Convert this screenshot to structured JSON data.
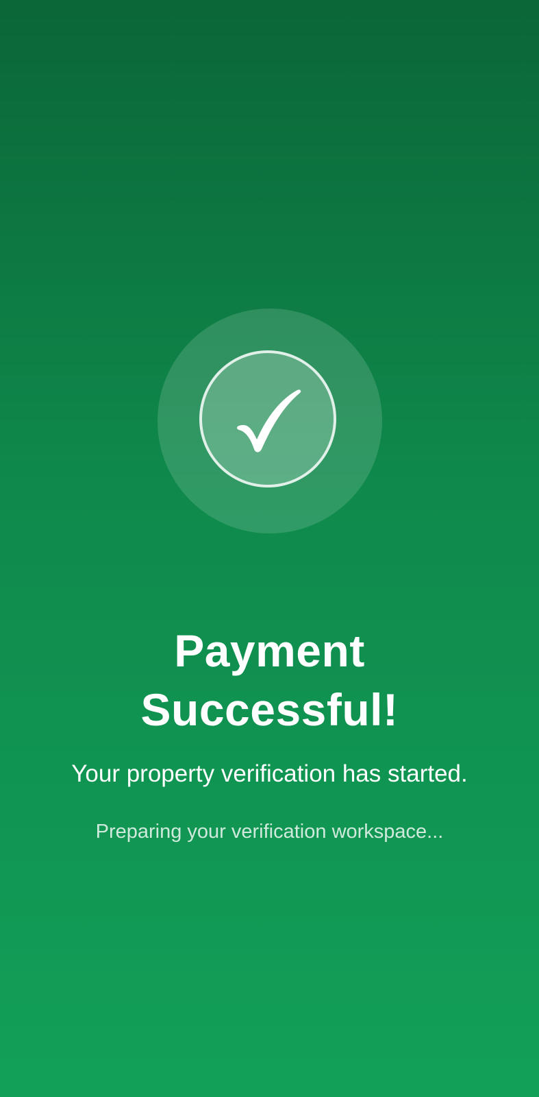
{
  "confirmation": {
    "title": "Payment\nSuccessful!",
    "message": "Your property verification has started.",
    "status": "Preparing your verification workspace...",
    "icon": "check-circle-icon"
  },
  "colors": {
    "background_top": "#0b6638",
    "background_bottom": "#12a058",
    "text": "#ffffff"
  }
}
